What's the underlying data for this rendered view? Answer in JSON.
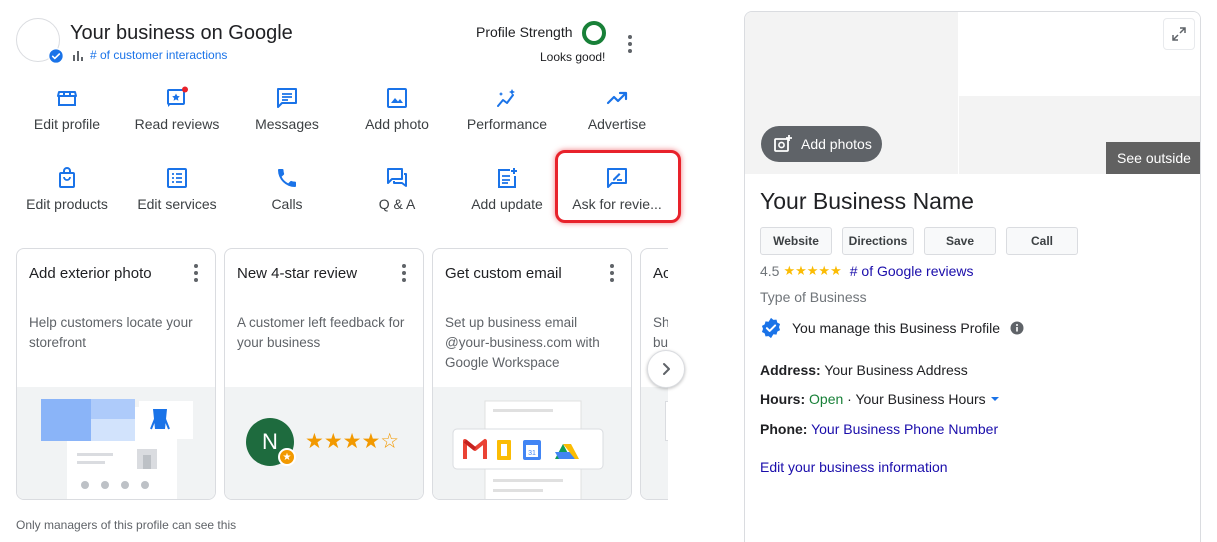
{
  "header": {
    "title": "Your business on Google",
    "interactions_link": "# of customer interactions",
    "profile_strength_label": "Profile Strength",
    "profile_strength_status": "Looks good!"
  },
  "actions_row1": [
    {
      "label": "Edit profile",
      "icon": "storefront-icon"
    },
    {
      "label": "Read reviews",
      "icon": "reviews-icon"
    },
    {
      "label": "Messages",
      "icon": "message-icon"
    },
    {
      "label": "Add photo",
      "icon": "photo-icon"
    },
    {
      "label": "Performance",
      "icon": "performance-icon"
    },
    {
      "label": "Advertise",
      "icon": "trending-up-icon"
    }
  ],
  "actions_row2": [
    {
      "label": "Edit products",
      "icon": "shopping-bag-icon"
    },
    {
      "label": "Edit services",
      "icon": "list-icon"
    },
    {
      "label": "Calls",
      "icon": "phone-icon"
    },
    {
      "label": "Q & A",
      "icon": "qa-icon"
    },
    {
      "label": "Add update",
      "icon": "post-add-icon"
    },
    {
      "label": "Ask for revie...",
      "icon": "rate-review-icon"
    }
  ],
  "cards": [
    {
      "title": "Add exterior photo",
      "body": "Help customers locate your storefront"
    },
    {
      "title": "New 4-star review",
      "body": "A customer left feedback for your business",
      "avatar_letter": "N",
      "stars": "★★★★☆"
    },
    {
      "title": "Get custom email",
      "body": "Set up business email @your-business.com with Google Workspace"
    },
    {
      "title": "Ac",
      "body": "Sh bu"
    }
  ],
  "footnote": "Only managers of this profile can see this",
  "knowledge_panel": {
    "add_photos": "Add photos",
    "see_outside": "See outside",
    "name": "Your Business Name",
    "buttons": [
      "Website",
      "Directions",
      "Save",
      "Call"
    ],
    "rating": "4.5",
    "stars": "★★★★★",
    "reviews_link": "# of Google reviews",
    "type": "Type of Business",
    "manage_text": "You manage this Business Profile",
    "address_label": "Address:",
    "address_value": "Your Business Address",
    "hours_label": "Hours:",
    "hours_open": "Open",
    "hours_sep": "·",
    "hours_value": "Your Business Hours",
    "phone_label": "Phone:",
    "phone_value": "Your Business Phone Number",
    "edit_link": "Edit your business information"
  },
  "colors": {
    "accent_blue": "#1a73e8",
    "strength_green": "#188038",
    "highlight_red": "#e8222b",
    "star_yellow": "#fbbc04",
    "link_purple": "#1a0dab"
  }
}
